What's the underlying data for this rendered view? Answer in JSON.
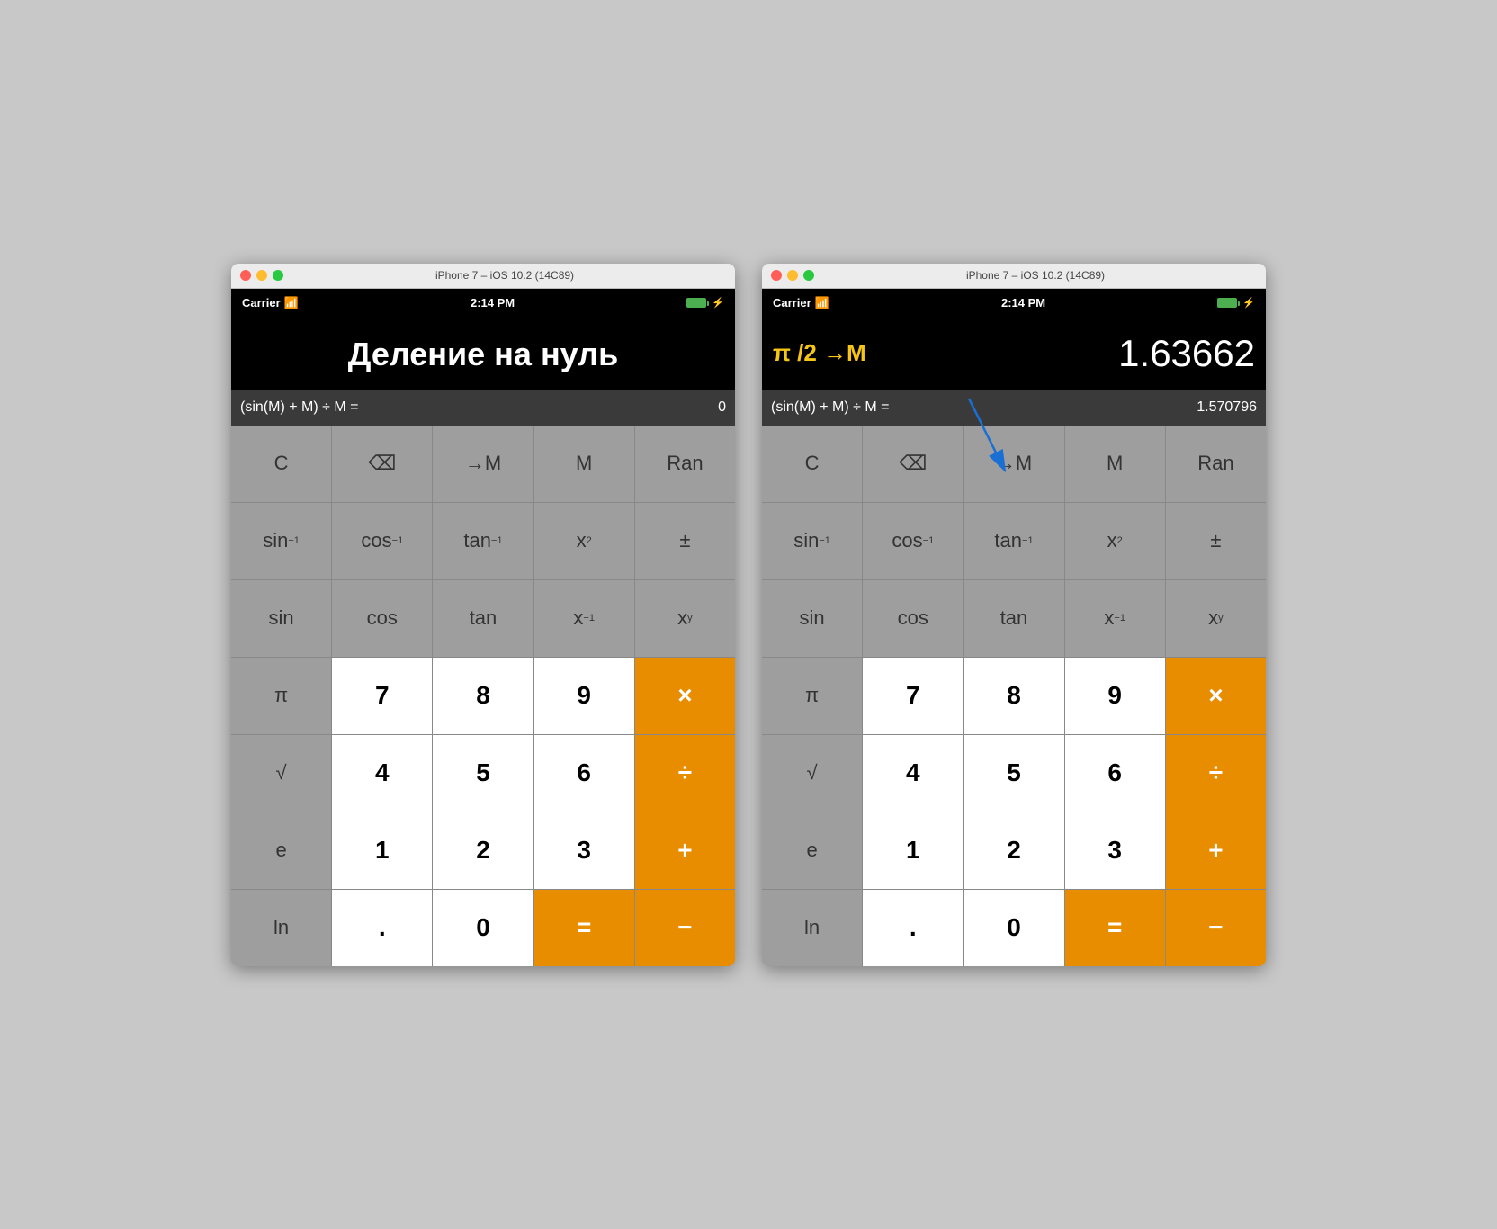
{
  "titleBar": {
    "title": "iPhone 7 – iOS 10.2 (14C89)",
    "buttons": [
      "close",
      "minimize",
      "maximize"
    ]
  },
  "statusBar": {
    "carrier": "Carrier",
    "time": "2:14 PM"
  },
  "left": {
    "displayTitle": "Деление на нуль",
    "formula": "(sin(M) + M) ÷ M =",
    "formulaResult": "0",
    "buttons": [
      [
        "C",
        "⌫",
        "→M",
        "M",
        "Ran"
      ],
      [
        "sin⁻¹",
        "cos⁻¹",
        "tan⁻¹",
        "x²",
        "±"
      ],
      [
        "sin",
        "cos",
        "tan",
        "x⁻¹",
        "xʸ"
      ],
      [
        "π",
        "7",
        "8",
        "9",
        "×"
      ],
      [
        "√",
        "4",
        "5",
        "6",
        "÷"
      ],
      [
        "e",
        "1",
        "2",
        "3",
        "+"
      ],
      [
        "ln",
        ".",
        "0",
        "=",
        "−"
      ]
    ]
  },
  "right": {
    "piLabel": "π /2 →M",
    "resultBig": "1.63662",
    "formula": "(sin(M) + M) ÷ M =",
    "formulaResult": "1.570796",
    "buttons": [
      [
        "C",
        "⌫",
        "→M",
        "M",
        "Ran"
      ],
      [
        "sin⁻¹",
        "cos⁻¹",
        "tan⁻¹",
        "x²",
        "±"
      ],
      [
        "sin",
        "cos",
        "tan",
        "x⁻¹",
        "xʸ"
      ],
      [
        "π",
        "7",
        "8",
        "9",
        "×"
      ],
      [
        "√",
        "4",
        "5",
        "6",
        "÷"
      ],
      [
        "e",
        "1",
        "2",
        "3",
        "+"
      ],
      [
        "ln",
        ".",
        "0",
        "=",
        "−"
      ]
    ]
  },
  "colors": {
    "orange": "#e88c00",
    "white": "#ffffff",
    "darkGray": "#9e9e9e",
    "black": "#000000",
    "yellow": "#f5c518",
    "blue": "#1a6fd4"
  }
}
